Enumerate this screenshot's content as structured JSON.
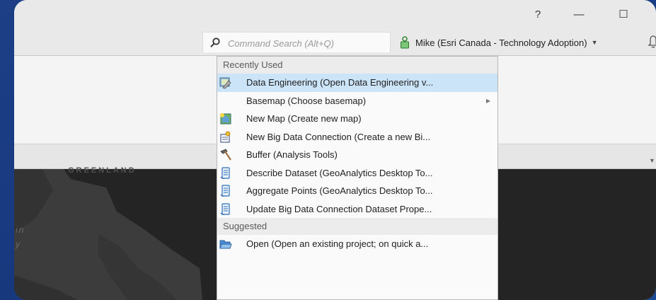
{
  "window": {
    "help_label": "?",
    "minimize_label": "—",
    "maximize_label": "☐"
  },
  "search": {
    "placeholder": "Command Search (Alt+Q)",
    "icon": "search-icon"
  },
  "user": {
    "name": "Mike (Esri Canada - Technology Adoption)",
    "icon": "user-icon"
  },
  "map": {
    "label_top": "GREENLAND",
    "label_side_1": "in",
    "label_side_2": "y"
  },
  "dropdown": {
    "recent_header": "Recently Used",
    "suggested_header": "Suggested",
    "recent_items": [
      {
        "label": "Data Engineering (Open Data Engineering v...",
        "icon": "data-engineering-icon",
        "selected": true
      },
      {
        "label": "Basemap (Choose basemap)",
        "icon": "",
        "submenu": true
      },
      {
        "label": "New Map (Create new map)",
        "icon": "new-map-icon"
      },
      {
        "label": "New Big Data Connection (Create a new Bi...",
        "icon": "big-data-connection-icon"
      },
      {
        "label": "Buffer (Analysis Tools)",
        "icon": "hammer-icon"
      },
      {
        "label": "Describe Dataset (GeoAnalytics Desktop To...",
        "icon": "script-icon"
      },
      {
        "label": "Aggregate Points (GeoAnalytics Desktop To...",
        "icon": "script-icon"
      },
      {
        "label": "Update Big Data Connection Dataset Prope...",
        "icon": "script-icon"
      }
    ],
    "suggested_items": [
      {
        "label": "Open (Open an existing project; on quick a...",
        "icon": "folder-open-icon"
      }
    ]
  }
}
